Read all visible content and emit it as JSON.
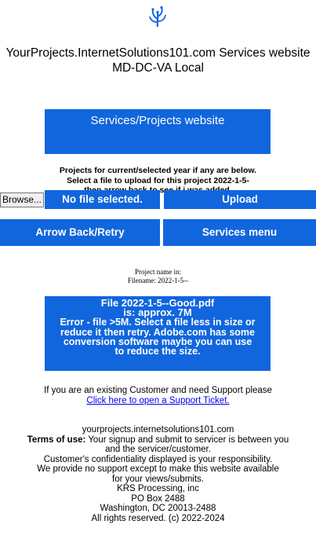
{
  "logo": {
    "icon": "wave-plant-logo-icon",
    "color": "#1166dd"
  },
  "site": {
    "title_line1": "YourProjects.InternetSolutions101.com Services website",
    "title_line2": "MD-DC-VA Local"
  },
  "banner": {
    "label": "Services/Projects website"
  },
  "projects_info": {
    "line1": "Projects for current/selected year if any are below.",
    "line2": "Select a file to upload for this project 2022-1-5-",
    "line3": "then arrow back to see if i was added."
  },
  "upload": {
    "browse_label": "Browse...",
    "file_status": "No file selected.",
    "upload_label": "Upload"
  },
  "nav": {
    "arrow_back_label": "Arrow Back/Retry",
    "services_menu_label": "Services menu"
  },
  "project": {
    "name_label": "Project name in:",
    "filename_label": "Filename: 2022-1-5--"
  },
  "error": {
    "line1": "File 2022-1-5--Good.pdf",
    "line2": "is: approx. 7M",
    "line3": "Error - file >5M. Select a file less in size or",
    "line4": "reduce it then retry. Adobe.com has some",
    "line5": "conversion software maybe you can use",
    "line6": "to reduce the size."
  },
  "support": {
    "text": "If you are an existing Customer and need Support please",
    "link_label": "Click here to open a Support Ticket."
  },
  "footer": {
    "domain": "yourprojects.internetsolutions101.com",
    "terms_label": "Terms of use:",
    "terms_text_1": " Your signup and submit to servicer is between you",
    "terms_text_2": "and the servicer/customer.",
    "line_confidentiality": "Customer's confidentiality displayed is your responsibility.",
    "line_support_1": "We provide no support except to make this website available",
    "line_support_2": "for your views/submits.",
    "company": "KRS Processing, inc",
    "po_box": "PO Box 2488",
    "city": "Washington, DC 20013-2488",
    "rights": "All rights reserved. (c) 2022-2024"
  },
  "colors": {
    "accent": "#1166dd",
    "link": "#0000ee"
  }
}
